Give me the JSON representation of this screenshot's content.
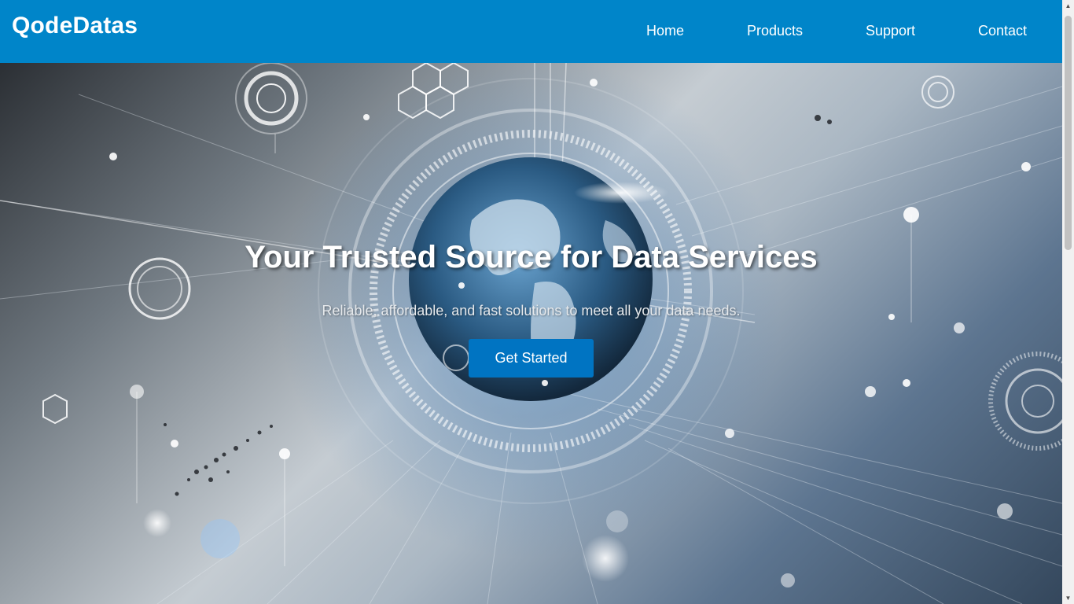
{
  "header": {
    "brand": "QodeDatas",
    "nav": [
      "Home",
      "Products",
      "Support",
      "Contact"
    ]
  },
  "hero": {
    "title": "Your Trusted Source for Data Services",
    "subtitle": "Reliable, affordable, and fast solutions to meet all your data needs.",
    "cta_label": "Get Started"
  },
  "colors": {
    "header_bg": "#0085c9",
    "cta_bg": "#0074c2",
    "text": "#ffffff"
  },
  "icons": {
    "scroll_up": "triangle-up",
    "scroll_down": "triangle-down"
  }
}
